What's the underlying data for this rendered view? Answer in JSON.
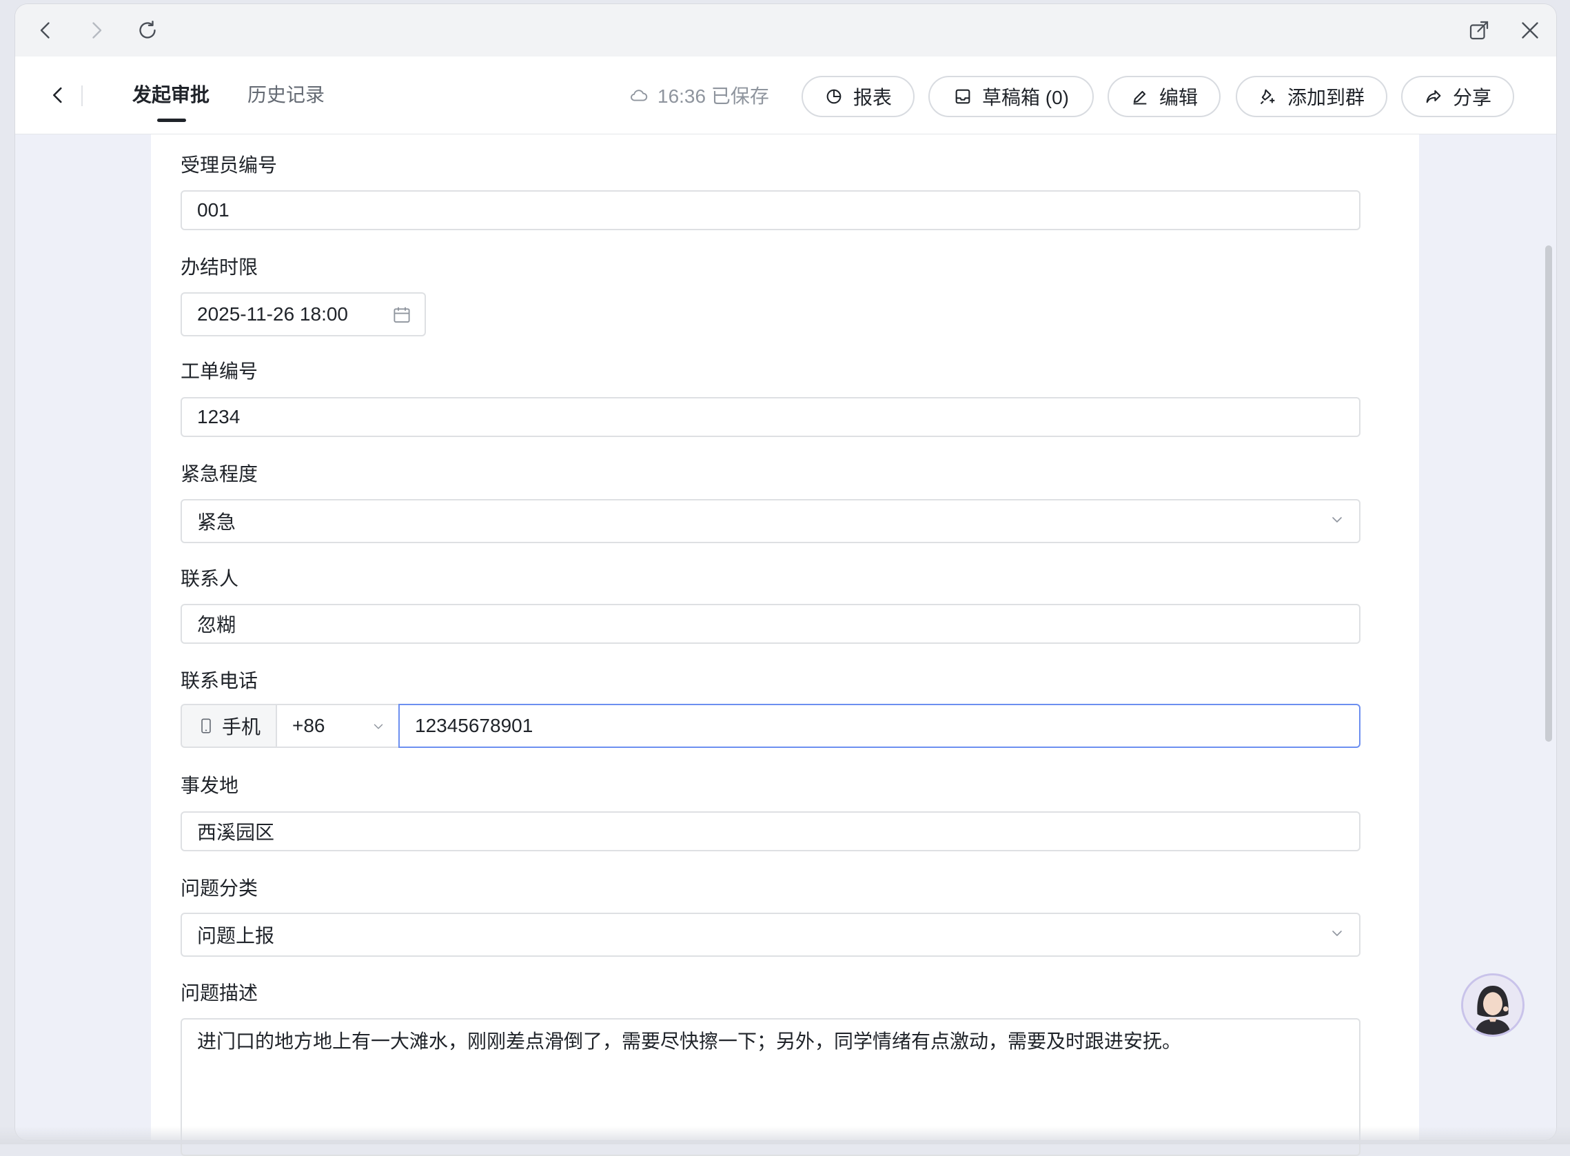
{
  "header": {
    "tabs": [
      {
        "label": "发起审批",
        "active": true
      },
      {
        "label": "历史记录",
        "active": false
      }
    ],
    "saved_status": "16:36 已保存",
    "buttons": {
      "report": "报表",
      "drafts": "草稿箱 (0)",
      "edit": "编辑",
      "add_to_group": "添加到群",
      "share": "分享"
    }
  },
  "form": {
    "handler_id": {
      "label": "受理员编号",
      "value": "001"
    },
    "deadline": {
      "label": "办结时限",
      "value": "2025-11-26 18:00"
    },
    "ticket_no": {
      "label": "工单编号",
      "value": "1234"
    },
    "urgency": {
      "label": "紧急程度",
      "value": "紧急"
    },
    "contact": {
      "label": "联系人",
      "value": "忽糊"
    },
    "phone": {
      "label": "联系电话",
      "type": "手机",
      "country_code": "+86",
      "value": "12345678901"
    },
    "location": {
      "label": "事发地",
      "value": "西溪园区"
    },
    "category": {
      "label": "问题分类",
      "value": "问题上报"
    },
    "description": {
      "label": "问题描述",
      "value": "进门口的地方地上有一大滩水，刚刚差点滑倒了，需要尽快擦一下；另外，同学情绪有点激动，需要及时跟进安抚。"
    }
  },
  "colors": {
    "accent_focus": "#6c8ff0",
    "content_bg": "#eef0f8"
  }
}
